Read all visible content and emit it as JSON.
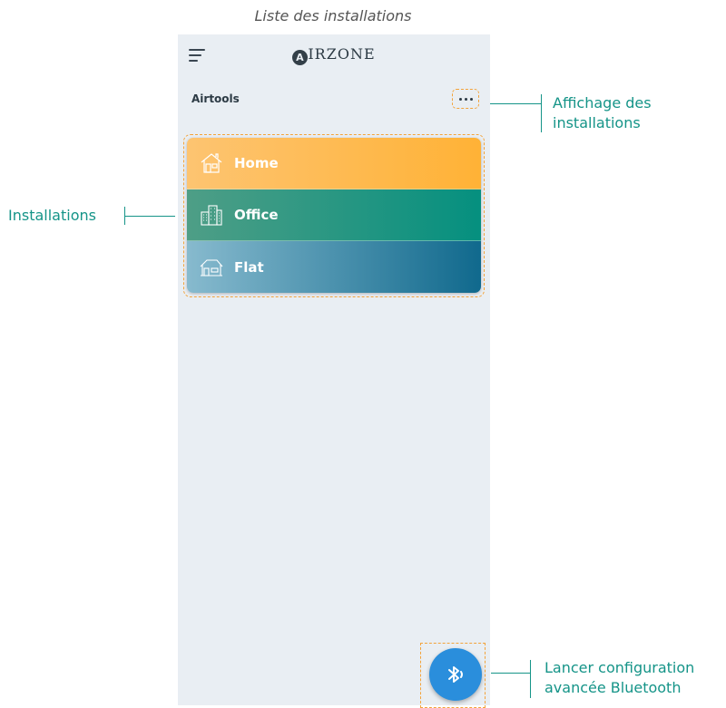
{
  "document": {
    "title": "Liste des installations"
  },
  "app": {
    "logo_mark": "A",
    "logo_text": "IRZONE",
    "section_label": "Airtools",
    "more_options_icon": "more-dots-icon",
    "menu_icon": "hamburger-menu-icon"
  },
  "installations": [
    {
      "label": "Home",
      "icon": "house-icon",
      "color": "#ffb236"
    },
    {
      "label": "Office",
      "icon": "office-building-icon",
      "color": "#05907f"
    },
    {
      "label": "Flat",
      "icon": "flat-building-icon",
      "color": "#10698d"
    }
  ],
  "bluetooth_button": {
    "icon": "bluetooth-icon",
    "color": "#2a8edc"
  },
  "callouts": {
    "display": {
      "line1": "Affichage des",
      "line2": "installations"
    },
    "installations": {
      "text": "Installations"
    },
    "bluetooth": {
      "line1": "Lancer configuration",
      "line2": "avancée Bluetooth"
    }
  },
  "accent_color": "#159488",
  "highlight_color": "#f3a33a"
}
